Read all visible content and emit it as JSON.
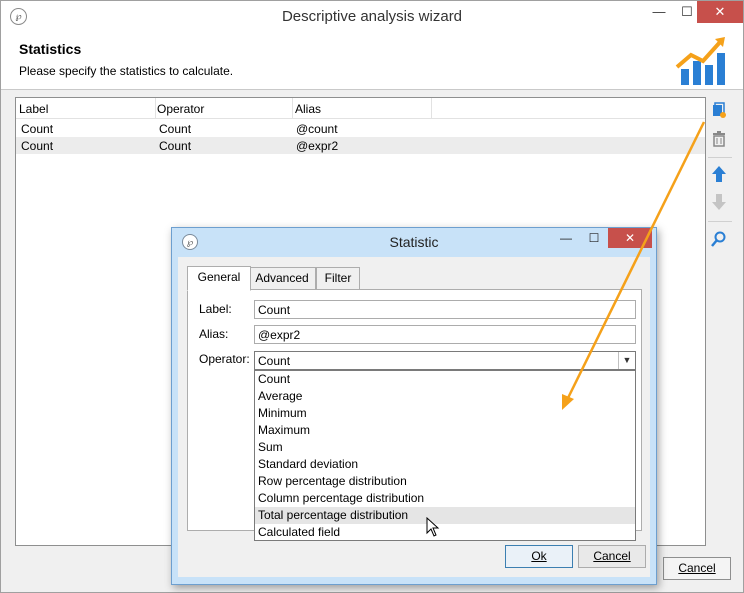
{
  "window": {
    "title": "Descriptive analysis wizard",
    "app_icon_text": "℘"
  },
  "header": {
    "title": "Statistics",
    "subtitle": "Please specify the statistics to calculate."
  },
  "grid": {
    "columns": [
      "Label",
      "Operator",
      "Alias"
    ],
    "rows": [
      {
        "label": "Count",
        "operator": "Count",
        "alias": "@count"
      },
      {
        "label": "Count",
        "operator": "Count",
        "alias": "@expr2"
      }
    ]
  },
  "footer": {
    "cancel_label": "Cancel"
  },
  "dialog": {
    "title": "Statistic",
    "tabs": [
      "General",
      "Advanced",
      "Filter"
    ],
    "fields": {
      "label_caption": "Label:",
      "label_value": "Count",
      "alias_caption": "Alias:",
      "alias_value": "@expr2",
      "operator_caption": "Operator:",
      "operator_value": "Count"
    },
    "operator_options": [
      "Count",
      "Average",
      "Minimum",
      "Maximum",
      "Sum",
      "Standard deviation",
      "Row percentage distribution",
      "Column percentage distribution",
      "Total percentage distribution",
      "Calculated field"
    ],
    "highlighted_option": "Total percentage distribution",
    "ok_label": "Ok",
    "cancel_label": "Cancel"
  },
  "colors": {
    "accent_orange": "#f5a11a",
    "icon_blue": "#2a7fd4",
    "close_red": "#c7504b",
    "dialog_frame": "#c8e2f8"
  }
}
